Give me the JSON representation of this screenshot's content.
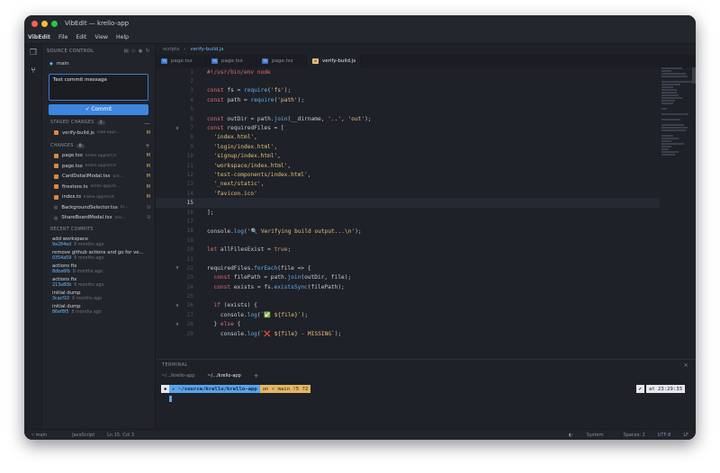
{
  "window": {
    "title": "VibEdit — krello-app"
  },
  "menu": {
    "app": "VibEdit",
    "items": [
      "File",
      "Edit",
      "View",
      "Help"
    ]
  },
  "sidebar": {
    "header": "SOURCE CONTROL",
    "branch": "main",
    "commit_message": "Test commit message",
    "commit_button": "✓ Commit",
    "staged": {
      "label": "STAGED CHANGES",
      "count": "1",
      "files": [
        {
          "name": "verify-build.js",
          "path": "vibe-appl...",
          "status": "M"
        }
      ]
    },
    "changes": {
      "label": "CHANGES",
      "count": "8",
      "files": [
        {
          "name": "page.tsx",
          "path": "krello-app/src/a...",
          "status": "M"
        },
        {
          "name": "page.tsx",
          "path": "krello-app/src/a...",
          "status": "M"
        },
        {
          "name": "CardDetailModal.tsx",
          "path": "kre...",
          "status": "M"
        },
        {
          "name": "firestore.ts",
          "path": "krello-app/sr...",
          "status": "M"
        },
        {
          "name": "index.ts",
          "path": "krello-app/src/ty...",
          "status": "M"
        },
        {
          "name": "BackgroundSelector.tsx",
          "path": "kr...",
          "status": "U"
        },
        {
          "name": "ShareBoardModal.tsx",
          "path": "kre...",
          "status": "U"
        }
      ]
    },
    "recent": {
      "label": "RECENT COMMITS",
      "commits": [
        {
          "message": "add workspace",
          "hash": "9a284ed",
          "time": "8 months ago"
        },
        {
          "message": "remove github actions and go for ve...",
          "hash": "0354a59",
          "time": "8 months ago"
        },
        {
          "message": "actions fix",
          "hash": "8dba6fb",
          "time": "8 months ago"
        },
        {
          "message": "actions fix",
          "hash": "213a80b",
          "time": "8 months ago"
        },
        {
          "message": "initial dump",
          "hash": "3cacf10",
          "time": "8 months ago"
        },
        {
          "message": "initial dump",
          "hash": "86ef8f5",
          "time": "8 months ago"
        }
      ]
    }
  },
  "editor": {
    "breadcrumb": {
      "folder": "scripts",
      "sep": "›",
      "file": "verify-build.js"
    },
    "tabs": [
      {
        "label": "page.tsx",
        "icon": "TS"
      },
      {
        "label": "page.tsx",
        "icon": "TS"
      },
      {
        "label": "page.tsx",
        "icon": "TS"
      },
      {
        "label": "verify-build.js",
        "icon": "JS"
      }
    ],
    "current_line": 15,
    "lines": [
      {
        "n": "1",
        "text": "#!/usr/bin/env node"
      },
      {
        "n": "2",
        "text": ""
      },
      {
        "n": "3",
        "text": "const fs = require('fs');"
      },
      {
        "n": "4",
        "text": "const path = require('path');"
      },
      {
        "n": "5",
        "text": ""
      },
      {
        "n": "6",
        "text": "const outDir = path.join(__dirname, '..', 'out');"
      },
      {
        "n": "7",
        "text": "const requiredFiles = ["
      },
      {
        "n": "8",
        "text": "  'index.html',"
      },
      {
        "n": "9",
        "text": "  'login/index.html',"
      },
      {
        "n": "10",
        "text": "  'signup/index.html',"
      },
      {
        "n": "11",
        "text": "  'workspace/index.html',"
      },
      {
        "n": "12",
        "text": "  'test-components/index.html',"
      },
      {
        "n": "13",
        "text": "  '_next/static',"
      },
      {
        "n": "14",
        "text": "  'favicon.ico'"
      },
      {
        "n": "15",
        "text": ""
      },
      {
        "n": "16",
        "text": "];"
      },
      {
        "n": "17",
        "text": ""
      },
      {
        "n": "18",
        "text": "console.log('🔍 Verifying build output...\\n');"
      },
      {
        "n": "19",
        "text": ""
      },
      {
        "n": "20",
        "text": "let allFilesExist = true;"
      },
      {
        "n": "21",
        "text": ""
      },
      {
        "n": "22",
        "text": "requiredFiles.forEach(file => {"
      },
      {
        "n": "23",
        "text": "  const filePath = path.join(outDir, file);"
      },
      {
        "n": "24",
        "text": "  const exists = fs.existsSync(filePath);"
      },
      {
        "n": "25",
        "text": ""
      },
      {
        "n": "26",
        "text": "  if (exists) {"
      },
      {
        "n": "27",
        "text": "    console.log(`✅ ${file}`);"
      },
      {
        "n": "28",
        "text": "  } else {"
      },
      {
        "n": "29",
        "text": "    console.log(`❌ ${file} - MISSING`);"
      }
    ]
  },
  "terminal": {
    "header": "TERMINAL",
    "close": "×",
    "tabs": [
      "~/.../krello-app",
      "~/.../krello-app"
    ],
    "add": "+",
    "prompt_path": "~/source/krello/krello-app",
    "prompt_on": "on",
    "prompt_branch": "main !5 ?2",
    "prompt_time": "at 23:29:33"
  },
  "status": {
    "branch": "main",
    "language": "JavaScript",
    "cursor": "Ln 15, Col 3",
    "theme": "System",
    "spaces": "Spaces: 2",
    "encoding": "UTF-8",
    "eol": "LF"
  }
}
